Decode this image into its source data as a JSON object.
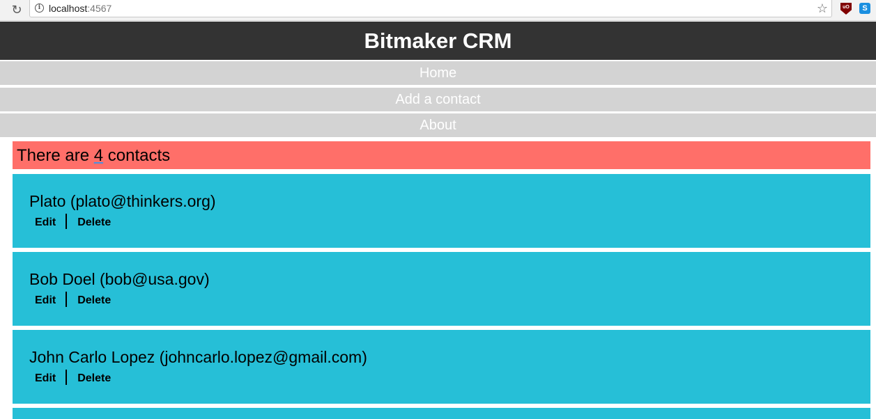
{
  "browser": {
    "url_host": "localhost",
    "url_port": ":4567",
    "ublock_label": "uO",
    "skype_label": "S"
  },
  "site": {
    "title": "Bitmaker CRM"
  },
  "nav": {
    "home": "Home",
    "add_contact": "Add a contact",
    "about": "About"
  },
  "summary": {
    "prefix": "There are ",
    "count": "4",
    "suffix": " contacts"
  },
  "contacts": [
    {
      "label": "Plato (plato@thinkers.org)",
      "edit": "Edit",
      "delete": "Delete"
    },
    {
      "label": "Bob Doel (bob@usa.gov)",
      "edit": "Edit",
      "delete": "Delete"
    },
    {
      "label": "John Carlo Lopez (johncarlo.lopez@gmail.com)",
      "edit": "Edit",
      "delete": "Delete"
    }
  ],
  "colors": {
    "header_bg": "#333333",
    "nav_bg": "#d3d3d3",
    "banner_bg": "#ff6f69",
    "card_bg": "#26bfd7"
  }
}
